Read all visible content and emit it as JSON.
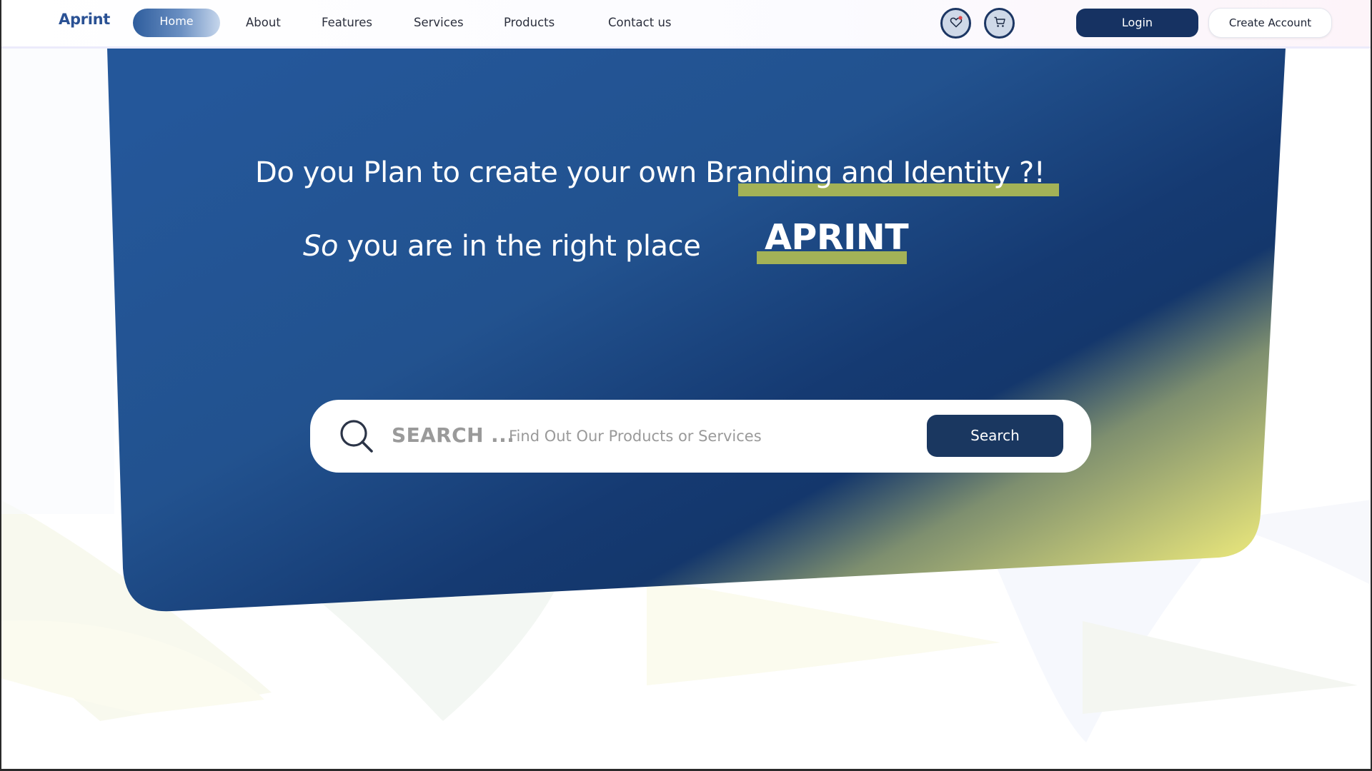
{
  "header": {
    "logo": "Aprint",
    "nav": {
      "home": "Home",
      "about": "About",
      "features": "Features",
      "services": "Services",
      "products": "Products",
      "contact": "Contact us"
    },
    "icons": [
      "heart-icon",
      "cart-icon"
    ],
    "login_label": "Login",
    "create_account_label": "Create Account"
  },
  "hero": {
    "headline": "Do you Plan to create your own Branding and Identity ?!",
    "subline_italic": "So",
    "subline_rest": " you are in the right place",
    "brand": "APRINT"
  },
  "search": {
    "label": "SEARCH ...",
    "placeholder": "Find Out Our Products or Services",
    "value": "",
    "button_label": "Search",
    "icon": "search-icon"
  },
  "colors": {
    "primary": "#163262",
    "hero_blue": "#24579a",
    "accent_green": "#a3b257",
    "hero_yellow": "#dfe07a",
    "logo_blue": "#2a5194"
  }
}
